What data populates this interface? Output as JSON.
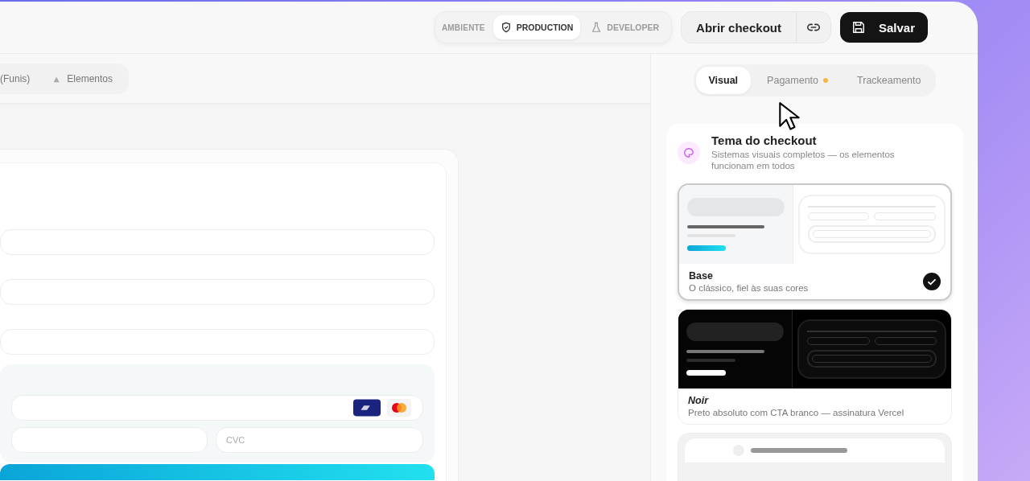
{
  "header": {
    "environment": {
      "label": "AMBIENTE",
      "options": [
        {
          "label": "PRODUCTION",
          "selected": true
        },
        {
          "label": "DEVELOPER",
          "selected": false
        }
      ]
    },
    "open_checkout": {
      "label": "Abrir checkout"
    },
    "save_button": {
      "label": "Salvar"
    }
  },
  "subnav": {
    "items": [
      {
        "label": "(Funis)"
      },
      {
        "label": "Elementos"
      }
    ]
  },
  "checkout_preview": {
    "card_fields": {
      "cvc_placeholder": "CVC"
    }
  },
  "panel": {
    "tabs": [
      {
        "label": "Visual",
        "selected": true,
        "pending": false
      },
      {
        "label": "Pagamento",
        "selected": false,
        "pending": true
      },
      {
        "label": "Trackeamento",
        "selected": false,
        "pending": false
      }
    ],
    "theme_section": {
      "title": "Tema do checkout",
      "subtitle": "Sistemas visuais completos — os elementos funcionam em todos",
      "themes": [
        {
          "kind": "light",
          "name": "Base",
          "description": "O clássico, fiel às suas cores",
          "selected": true
        },
        {
          "kind": "dark",
          "name": "Noir",
          "description": "Preto absoluto com CTA branco — assinatura Vercel",
          "selected": false
        },
        {
          "kind": "soft",
          "selected": false
        }
      ]
    }
  }
}
